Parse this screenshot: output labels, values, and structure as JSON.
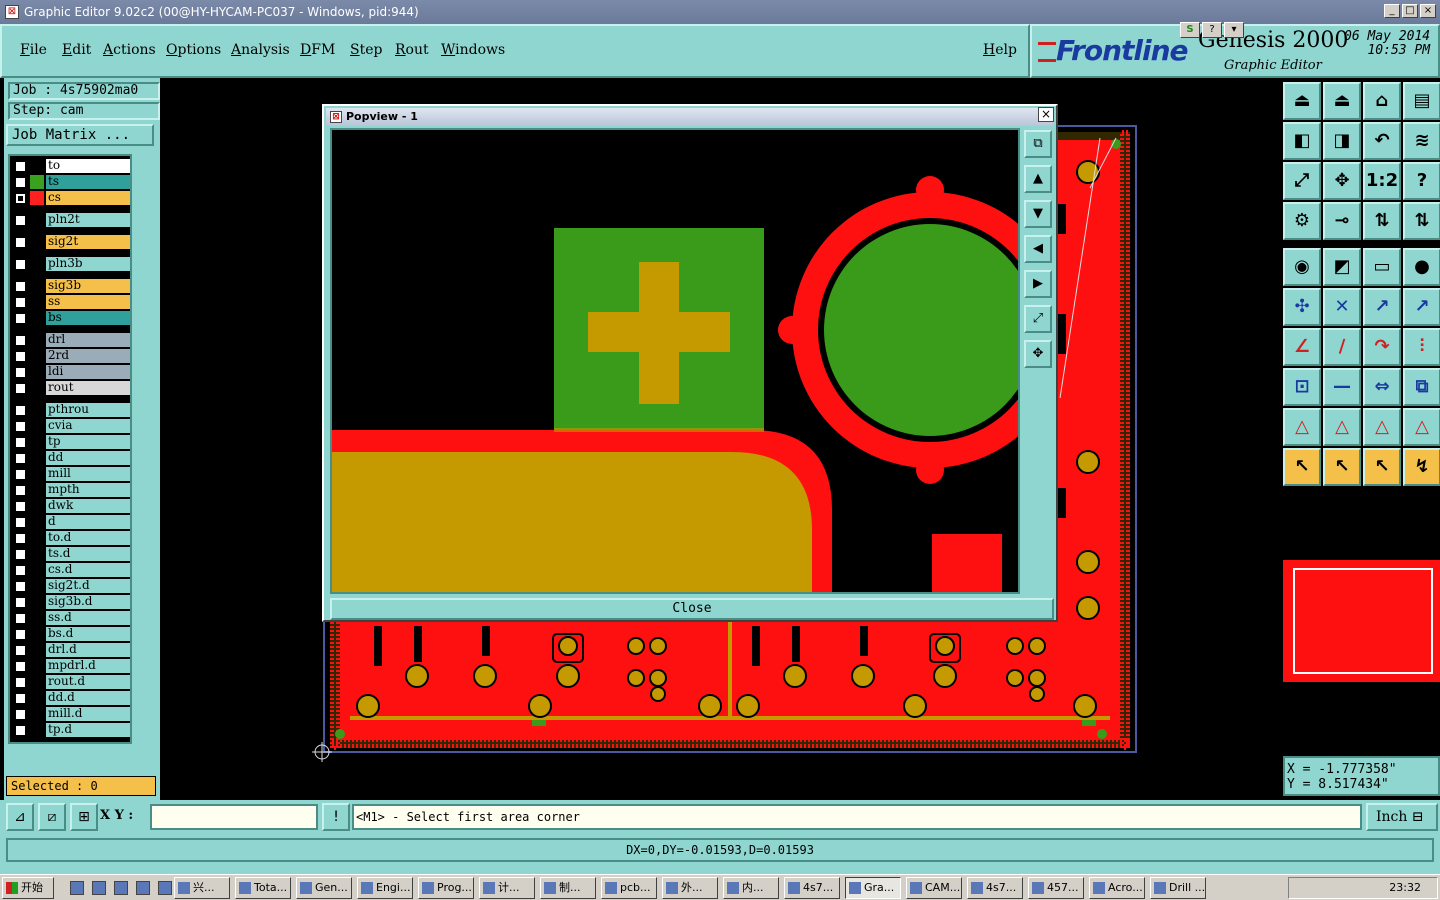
{
  "window": {
    "title": "Graphic Editor 9.02c2 (00@HY-HYCAM-PC037 - Windows, pid:944)",
    "controls": [
      "_",
      "□",
      "×"
    ]
  },
  "menu": [
    "File",
    "Edit",
    "Actions",
    "Options",
    "Analysis",
    "DFM",
    "Step",
    "Rout",
    "Windows"
  ],
  "help": "Help",
  "brand": {
    "logo": "Frontline",
    "product": "Genesis 2000",
    "subtitle": "Graphic Editor",
    "date": "06 May 2014",
    "time": "10:53 PM",
    "top_tools": [
      "S",
      "?",
      "▾"
    ]
  },
  "job": "Job : 4s75902ma0",
  "step": "Step: cam",
  "job_matrix": "Job Matrix ...",
  "layers": [
    {
      "name": "to",
      "color": "#ffffff",
      "swatch": "#000000",
      "checked": false
    },
    {
      "name": "ts",
      "color": "#2fa09a",
      "swatch": "#3aa020",
      "checked": false
    },
    {
      "name": "cs",
      "color": "#f5c04a",
      "swatch": "#ff2020",
      "checked": true
    },
    {
      "name": "pln2t",
      "color": "#8fd6d0",
      "swatch": "#000000",
      "checked": false
    },
    {
      "name": "sig2t",
      "color": "#f5c04a",
      "swatch": "#000000",
      "checked": false
    },
    {
      "name": "pln3b",
      "color": "#8fd6d0",
      "swatch": "#000000",
      "checked": false
    },
    {
      "name": "sig3b",
      "color": "#f5c04a",
      "swatch": "#000000",
      "checked": false
    },
    {
      "name": "ss",
      "color": "#f5c04a",
      "swatch": "#000000",
      "checked": false
    },
    {
      "name": "bs",
      "color": "#2fa09a",
      "swatch": "#000000",
      "checked": false
    },
    {
      "name": "drl",
      "color": "#9aacb8",
      "swatch": "#000000",
      "checked": false
    },
    {
      "name": "2rd",
      "color": "#9aacb8",
      "swatch": "#000000",
      "checked": false
    },
    {
      "name": "ldi",
      "color": "#9aacb8",
      "swatch": "#000000",
      "checked": false
    },
    {
      "name": "rout",
      "color": "#d8d8d8",
      "swatch": "#000000",
      "checked": false
    },
    {
      "name": "pthrou",
      "color": "#8fd6d0",
      "swatch": "#000000",
      "checked": false
    },
    {
      "name": "cvia",
      "color": "#8fd6d0",
      "swatch": "#000000",
      "checked": false
    },
    {
      "name": "tp",
      "color": "#8fd6d0",
      "swatch": "#000000",
      "checked": false
    },
    {
      "name": "dd",
      "color": "#8fd6d0",
      "swatch": "#000000",
      "checked": false
    },
    {
      "name": "mill",
      "color": "#8fd6d0",
      "swatch": "#000000",
      "checked": false
    },
    {
      "name": "mpth",
      "color": "#8fd6d0",
      "swatch": "#000000",
      "checked": false
    },
    {
      "name": "dwk",
      "color": "#8fd6d0",
      "swatch": "#000000",
      "checked": false
    },
    {
      "name": "d",
      "color": "#8fd6d0",
      "swatch": "#000000",
      "checked": false
    },
    {
      "name": "to.d",
      "color": "#8fd6d0",
      "swatch": "#000000",
      "checked": false
    },
    {
      "name": "ts.d",
      "color": "#8fd6d0",
      "swatch": "#000000",
      "checked": false
    },
    {
      "name": "cs.d",
      "color": "#8fd6d0",
      "swatch": "#000000",
      "checked": false
    },
    {
      "name": "sig2t.d",
      "color": "#8fd6d0",
      "swatch": "#000000",
      "checked": false
    },
    {
      "name": "sig3b.d",
      "color": "#8fd6d0",
      "swatch": "#000000",
      "checked": false
    },
    {
      "name": "ss.d",
      "color": "#8fd6d0",
      "swatch": "#000000",
      "checked": false
    },
    {
      "name": "bs.d",
      "color": "#8fd6d0",
      "swatch": "#000000",
      "checked": false
    },
    {
      "name": "drl.d",
      "color": "#8fd6d0",
      "swatch": "#000000",
      "checked": false
    },
    {
      "name": "mpdrl.d",
      "color": "#8fd6d0",
      "swatch": "#000000",
      "checked": false
    },
    {
      "name": "rout.d",
      "color": "#8fd6d0",
      "swatch": "#000000",
      "checked": false
    },
    {
      "name": "dd.d",
      "color": "#8fd6d0",
      "swatch": "#000000",
      "checked": false
    },
    {
      "name": "mill.d",
      "color": "#8fd6d0",
      "swatch": "#000000",
      "checked": false
    },
    {
      "name": "tp.d",
      "color": "#8fd6d0",
      "swatch": "#000000",
      "checked": false
    }
  ],
  "selected": "Selected : 0",
  "popup": {
    "title": "Popview - 1",
    "close_x": "×",
    "close_label": "Close",
    "tools": [
      "⧉",
      "▲",
      "▼",
      "◀",
      "▶",
      "⤢",
      "✥"
    ]
  },
  "toolbar_icons": [
    "⏏",
    "⏏",
    "⌂",
    "▤",
    "◧",
    "◨",
    "↶",
    "≋",
    "⤢",
    "✥",
    "1:2",
    "?",
    "⚙",
    "⊸",
    "⇅",
    "⇅",
    "◉",
    "◩",
    "▭",
    "●",
    "✣",
    "✕",
    "↗",
    "↗",
    "∠",
    "∕",
    "↷",
    "⫶",
    "⊡",
    "—",
    "⇔",
    "⧉",
    "△",
    "△",
    "△",
    "△",
    "↖",
    "↖",
    "↖",
    "↯"
  ],
  "coords": {
    "x": "X = -1.777358\"",
    "y": "Y = 8.517434\""
  },
  "cmd": {
    "xy_label": "X Y :",
    "xy_value": "",
    "prompt": "<M1> - Select first area corner",
    "unit": "Inch ⊟"
  },
  "status": "DX=0,DY=-0.01593,D=0.01593",
  "taskbar": {
    "start": "开始",
    "tasks": [
      "兴...",
      "Tota...",
      "Gen...",
      "Engi...",
      "Prog...",
      "计...",
      "制...",
      "pcb...",
      "外...",
      "内...",
      "4s7...",
      "Gra...",
      "CAM...",
      "4s7...",
      "457...",
      "Acro...",
      "Drill ..."
    ],
    "active_index": 11,
    "clock": "23:32"
  },
  "colors": {
    "panel": "#8fd6d0",
    "copper": "#ff1010",
    "mask": "#3a9a1a",
    "pad": "#c49a00"
  }
}
